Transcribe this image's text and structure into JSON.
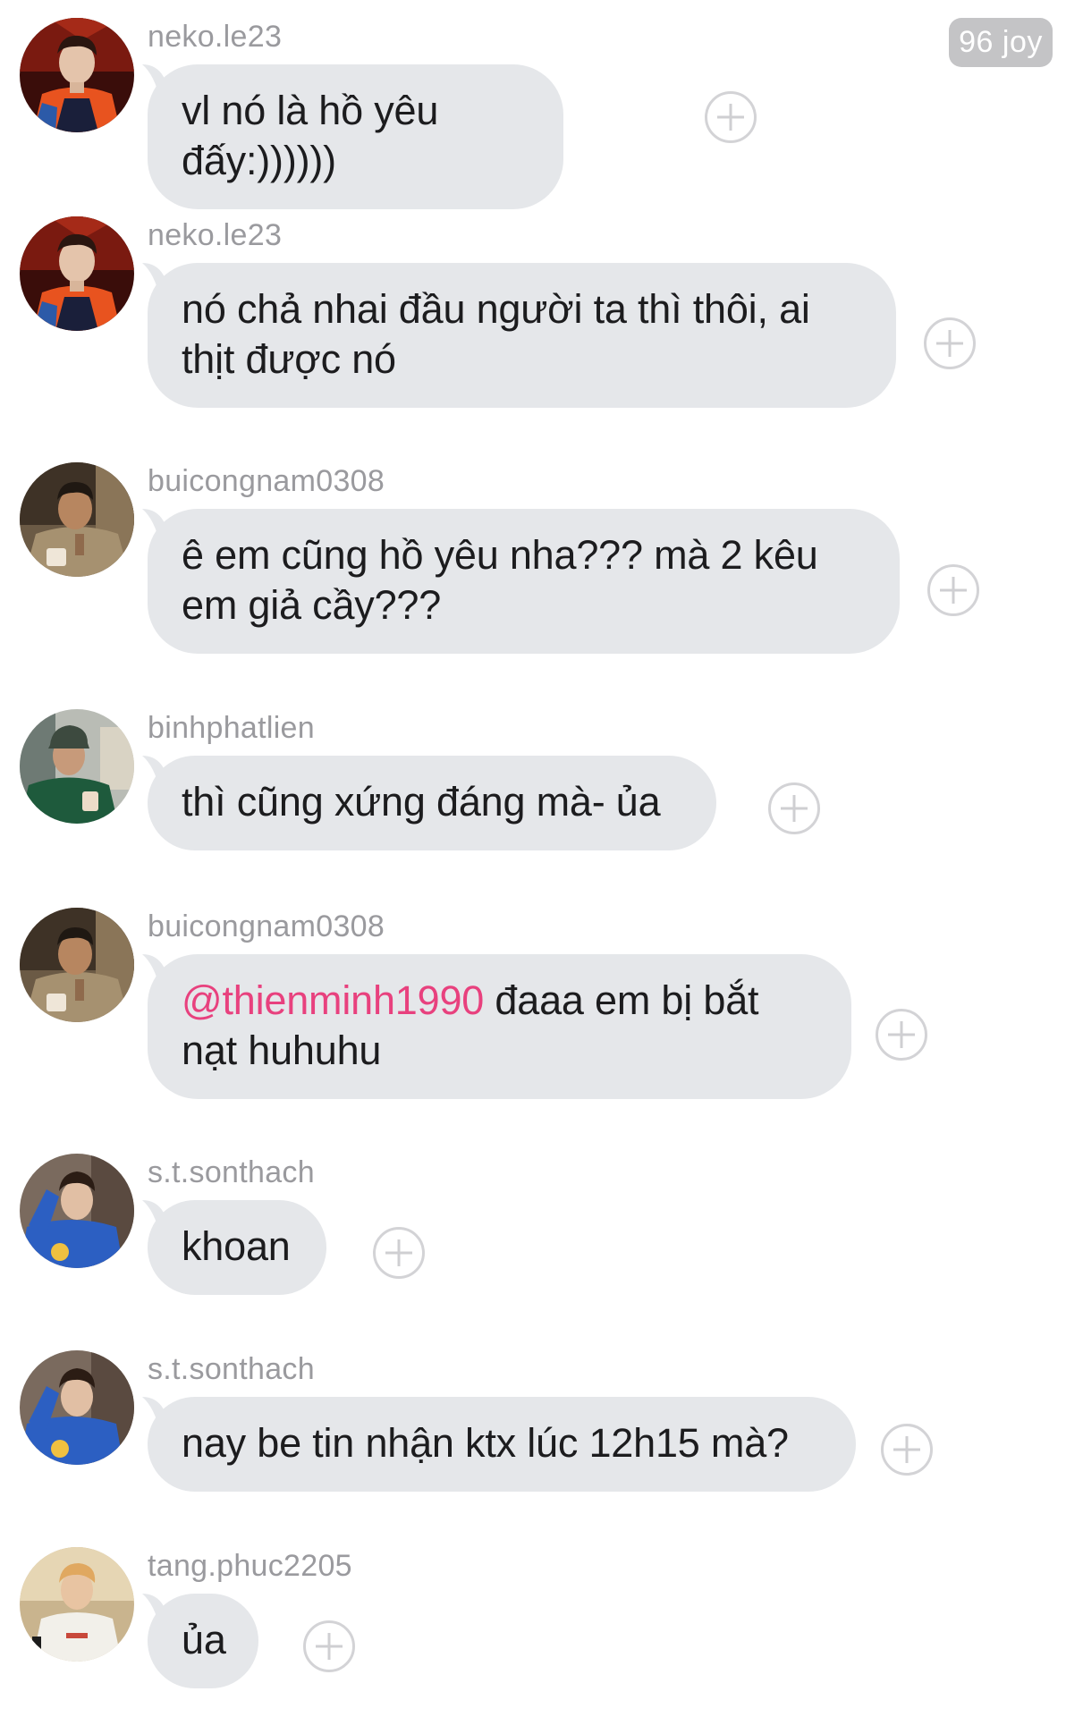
{
  "badge": {
    "label": "96 joy"
  },
  "messages": [
    {
      "username": "neko.le23",
      "text": "vl nó là hồ yêu đấy:))))))",
      "avatar_icon": "avatar-neko-le23-icon"
    },
    {
      "username": "neko.le23",
      "text": "nó chả nhai đầu người ta thì thôi, ai thịt được nó",
      "avatar_icon": "avatar-neko-le23-icon"
    },
    {
      "username": "buicongnam0308",
      "text": "ê em cũng hồ yêu nha??? mà 2 kêu em giả cầy???",
      "avatar_icon": "avatar-buicongnam0308-icon"
    },
    {
      "username": "binhphatlien",
      "text": "thì cũng xứng đáng mà- ủa",
      "avatar_icon": "avatar-binhphatlien-icon"
    },
    {
      "username": "buicongnam0308",
      "mention": "@thienminh1990",
      "text": " đaaa em bị bắt nạt huhuhu",
      "avatar_icon": "avatar-buicongnam0308-icon"
    },
    {
      "username": "s.t.sonthach",
      "text": "khoan",
      "avatar_icon": "avatar-s-t-sonthach-icon"
    },
    {
      "username": "s.t.sonthach",
      "text": "nay be tin nhận ktx lúc 12h15 mà?",
      "avatar_icon": "avatar-s-t-sonthach-icon"
    },
    {
      "username": "tang.phuc2205",
      "text": "ủa",
      "avatar_icon": "avatar-tang-phuc2205-icon"
    }
  ],
  "icons": {
    "add_reaction": "plus-circle-icon"
  },
  "colors": {
    "bubble": "#e5e7ea",
    "username": "#9a9a9e",
    "mention": "#e8417e",
    "badge_bg": "#c4c4c6"
  }
}
